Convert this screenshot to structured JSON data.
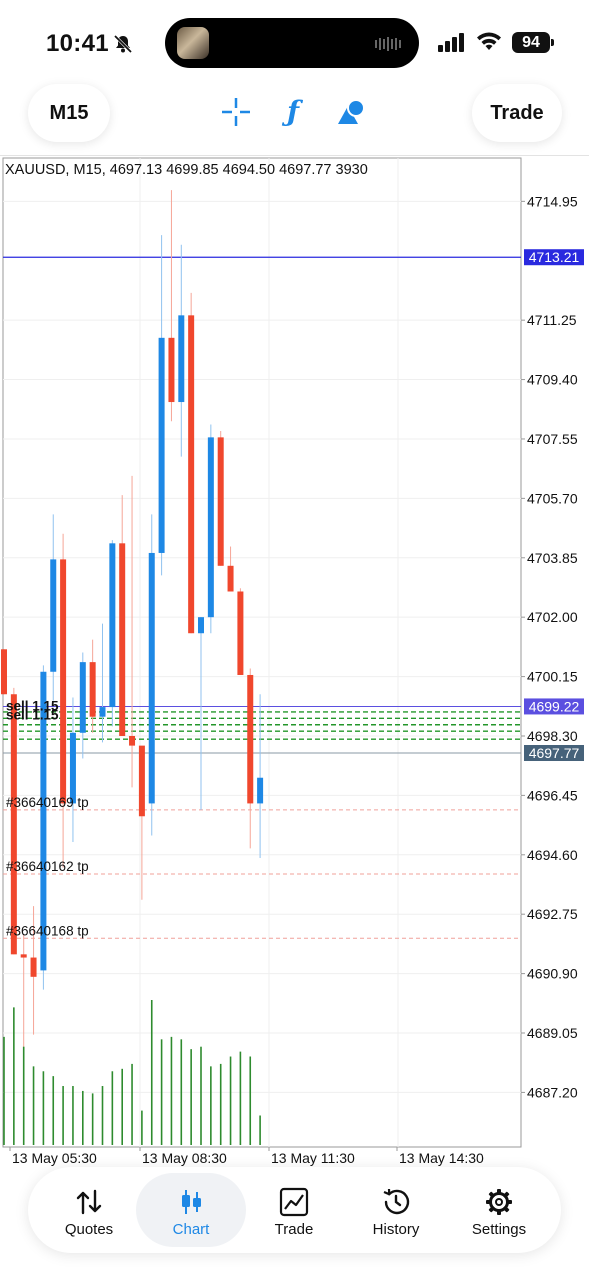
{
  "status_bar": {
    "time": "10:41",
    "battery": "94"
  },
  "toolbar": {
    "timeframe": "M15",
    "trade_label": "Trade"
  },
  "chart": {
    "symbol_line": "XAUUSD, M15, 4697.13 4699.85 4694.50 4697.77 3930",
    "price_labels": [
      "4714.95",
      "4711.25",
      "4709.40",
      "4707.55",
      "4705.70",
      "4703.85",
      "4702.00",
      "4700.15",
      "4698.30",
      "4696.45",
      "4694.60",
      "4692.75",
      "4690.90",
      "4689.05",
      "4687.20"
    ],
    "blue_line_price": "4713.21",
    "ask_price": "4699.22",
    "bid_price": "4697.77",
    "time_labels": [
      "13 May 05:30",
      "13 May 08:30",
      "13 May 11:30",
      "13 May 14:30"
    ],
    "order_labels": [
      "sell 1.15"
    ],
    "tp_labels": [
      "#36640169 tp",
      "#36640162 tp",
      "#36640168 tp"
    ],
    "colors": {
      "bull": "#1e88e5",
      "bear": "#f0472d",
      "volume": "#2e8b2e",
      "ask": "#5b4fe0",
      "bid": "#46627a",
      "hline": "#2a2adf"
    }
  },
  "chart_data": {
    "type": "candlestick",
    "title": "XAUUSD, M15, 4697.13 4699.85 4694.50 4697.77 3930",
    "ylim": [
      4685.5,
      4716.3
    ],
    "candles": [
      {
        "o": 4701.0,
        "h": 4701.0,
        "l": 4699.6,
        "c": 4699.6
      },
      {
        "o": 4699.6,
        "h": 4699.8,
        "l": 4691.5,
        "c": 4691.5
      },
      {
        "o": 4691.5,
        "h": 4692.1,
        "l": 4687.6,
        "c": 4691.4
      },
      {
        "o": 4691.4,
        "h": 4693.0,
        "l": 4689.0,
        "c": 4690.8
      },
      {
        "o": 4691.0,
        "h": 4700.5,
        "l": 4690.4,
        "c": 4700.3
      },
      {
        "o": 4700.3,
        "h": 4705.2,
        "l": 4699.4,
        "c": 4703.8
      },
      {
        "o": 4703.8,
        "h": 4704.6,
        "l": 4694.2,
        "c": 4696.2
      },
      {
        "o": 4696.2,
        "h": 4699.5,
        "l": 4695.0,
        "c": 4698.4
      },
      {
        "o": 4698.4,
        "h": 4700.9,
        "l": 4697.6,
        "c": 4700.6
      },
      {
        "o": 4700.6,
        "h": 4701.3,
        "l": 4698.4,
        "c": 4698.9
      },
      {
        "o": 4698.9,
        "h": 4701.8,
        "l": 4698.1,
        "c": 4699.2
      },
      {
        "o": 4699.2,
        "h": 4704.4,
        "l": 4698.6,
        "c": 4704.3
      },
      {
        "o": 4704.3,
        "h": 4705.8,
        "l": 4698.3,
        "c": 4698.3
      },
      {
        "o": 4698.3,
        "h": 4706.4,
        "l": 4696.7,
        "c": 4698.0
      },
      {
        "o": 4698.0,
        "h": 4697.9,
        "l": 4693.2,
        "c": 4695.8
      },
      {
        "o": 4696.2,
        "h": 4705.2,
        "l": 4695.2,
        "c": 4704.0
      },
      {
        "o": 4704.0,
        "h": 4713.9,
        "l": 4703.3,
        "c": 4710.7
      },
      {
        "o": 4710.7,
        "h": 4715.3,
        "l": 4708.1,
        "c": 4708.7
      },
      {
        "o": 4708.7,
        "h": 4713.6,
        "l": 4707.0,
        "c": 4711.4
      },
      {
        "o": 4711.4,
        "h": 4712.1,
        "l": 4701.5,
        "c": 4701.5
      },
      {
        "o": 4701.5,
        "h": 4702.0,
        "l": 4696.0,
        "c": 4702.0
      },
      {
        "o": 4702.0,
        "h": 4708.0,
        "l": 4701.5,
        "c": 4707.6
      },
      {
        "o": 4707.6,
        "h": 4707.8,
        "l": 4703.6,
        "c": 4703.6
      },
      {
        "o": 4703.6,
        "h": 4704.2,
        "l": 4702.8,
        "c": 4702.8
      },
      {
        "o": 4702.8,
        "h": 4702.9,
        "l": 4700.2,
        "c": 4700.2
      },
      {
        "o": 4700.2,
        "h": 4700.4,
        "l": 4694.8,
        "c": 4696.2
      },
      {
        "o": 4696.2,
        "h": 4699.6,
        "l": 4694.5,
        "c": 4697.0
      }
    ],
    "volume": [
      3870,
      3930,
      3850,
      3810,
      3800,
      3790,
      3770,
      3770,
      3760,
      3755,
      3770,
      3800,
      3805,
      3815,
      3720,
      3945,
      3865,
      3870,
      3865,
      3845,
      3850,
      3810,
      3815,
      3830,
      3840,
      3830,
      3710
    ],
    "xlabels": [
      "13 May 05:30",
      "13 May 08:30",
      "13 May 11:30",
      "13 May 14:30"
    ]
  },
  "nav": {
    "items": [
      {
        "label": "Quotes"
      },
      {
        "label": "Chart"
      },
      {
        "label": "Trade"
      },
      {
        "label": "History"
      },
      {
        "label": "Settings"
      }
    ]
  }
}
